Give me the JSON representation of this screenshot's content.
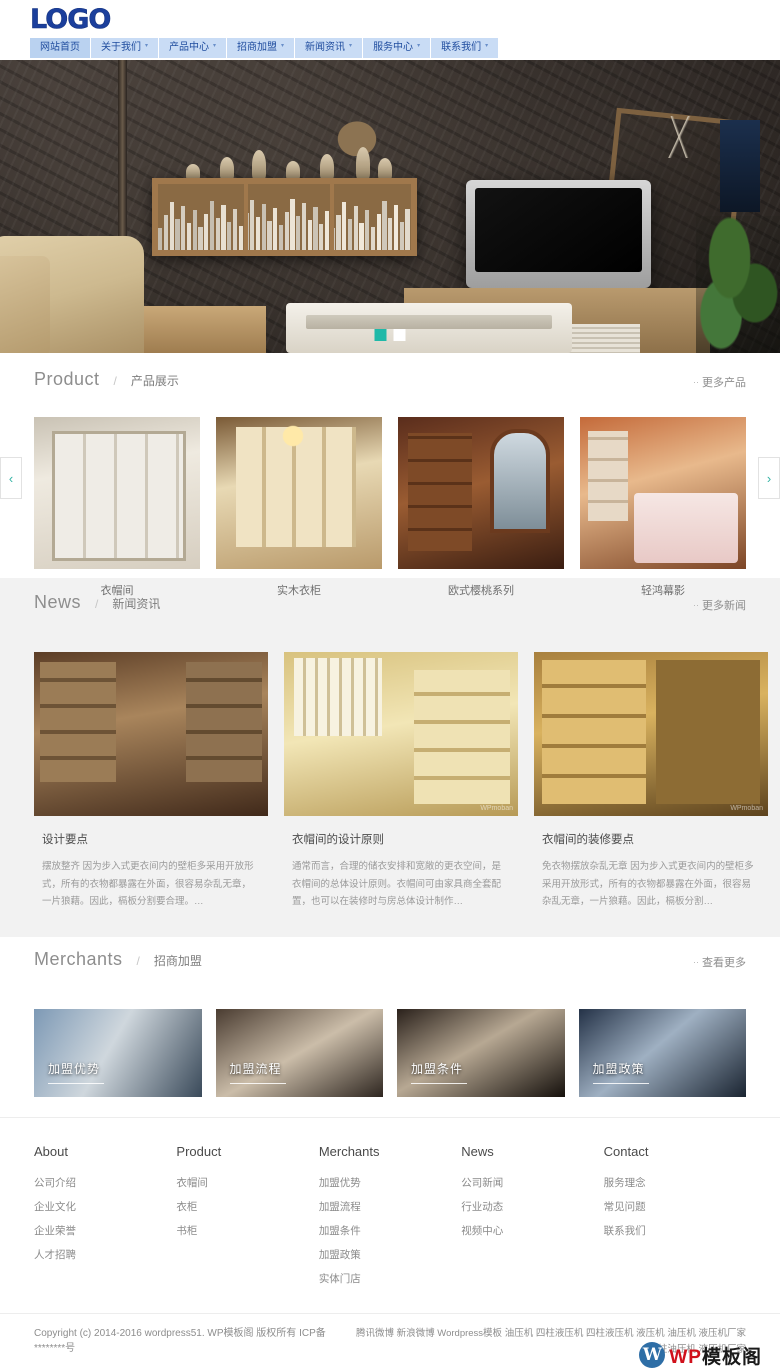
{
  "header": {
    "logo": "LOGO",
    "nav": [
      {
        "label": "网站首页",
        "has_caret": false
      },
      {
        "label": "关于我们",
        "has_caret": true
      },
      {
        "label": "产品中心",
        "has_caret": true
      },
      {
        "label": "招商加盟",
        "has_caret": true
      },
      {
        "label": "新闻资讯",
        "has_caret": true
      },
      {
        "label": "服务中心",
        "has_caret": true
      },
      {
        "label": "联系我们",
        "has_caret": true
      }
    ],
    "nav_bg": "#c9dcf5",
    "nav_color": "#1f4c9e",
    "logo_color": "#1b3f9c"
  },
  "hero": {
    "alt": "现代客厅家具展示 电视柜 书架",
    "slide_count": 2,
    "active_slide": 1,
    "active_color": "#1fb9a8"
  },
  "product": {
    "en": "Product",
    "slash": "/",
    "cn": "产品展示",
    "more": "更多产品",
    "prev": "‹",
    "next": "›",
    "items": [
      {
        "caption": "衣帽间"
      },
      {
        "caption": "实木衣柜"
      },
      {
        "caption": "欧式樱桃系列"
      },
      {
        "caption": "轻鸿幕影"
      }
    ]
  },
  "news": {
    "en": "News",
    "slash": "/",
    "cn": "新闻资讯",
    "more": "更多新闻",
    "items": [
      {
        "title": "设计要点",
        "excerpt": "摆放整齐 因为步入式更衣间内的壁柜多采用开放形式，所有的衣物都暴露在外面，很容易杂乱无章，一片狼藉。因此，槅板分割要合理。…",
        "watermark": ""
      },
      {
        "title": "衣帽间的设计原则",
        "excerpt": "通常而言，合理的储衣安排和宽敞的更衣空间，是衣帽间的总体设计原则。衣帽间可由家具商全套配置，也可以在装修时与房总体设计制作…",
        "watermark": "WPmoban"
      },
      {
        "title": "衣帽间的装修要点",
        "excerpt": "免衣物摆放杂乱无章 因为步入式更衣间内的壁柜多采用开放形式，所有的衣物都暴露在外面，很容易杂乱无章，一片狼藉。因此，槅板分割…",
        "watermark": "WPmoban"
      }
    ]
  },
  "merchants": {
    "en": "Merchants",
    "slash": "/",
    "cn": "招商加盟",
    "more": "查看更多",
    "items": [
      {
        "label": "加盟优势"
      },
      {
        "label": "加盟流程"
      },
      {
        "label": "加盟条件"
      },
      {
        "label": "加盟政策"
      }
    ]
  },
  "footer": {
    "columns": [
      {
        "title": "About",
        "links": [
          "公司介绍",
          "企业文化",
          "企业荣誉",
          "人才招聘"
        ]
      },
      {
        "title": "Product",
        "links": [
          "衣帽间",
          "衣柜",
          "书柜"
        ]
      },
      {
        "title": "Merchants",
        "links": [
          "加盟优势",
          "加盟流程",
          "加盟条件",
          "加盟政策",
          "实体门店"
        ]
      },
      {
        "title": "News",
        "links": [
          "公司新闻",
          "行业动态",
          "视频中心"
        ]
      },
      {
        "title": "Contact",
        "links": [
          "服务理念",
          "常见问题",
          "联系我们"
        ]
      }
    ]
  },
  "copyright": {
    "left": "Copyright (c) 2014-2016 wordpress51. WP模板阁 版权所有  ICP备********号",
    "right_links": [
      "腾讯微博",
      "新浪微博",
      "Wordpress模板",
      "油压机",
      "四柱液压机",
      "四柱液压机",
      "液压机",
      "油压机",
      "液压机厂家",
      "四柱油压机",
      "液压机厂家"
    ],
    "watermark_logo": "W",
    "watermark_en": "WP",
    "watermark_cn": "模板阁"
  }
}
